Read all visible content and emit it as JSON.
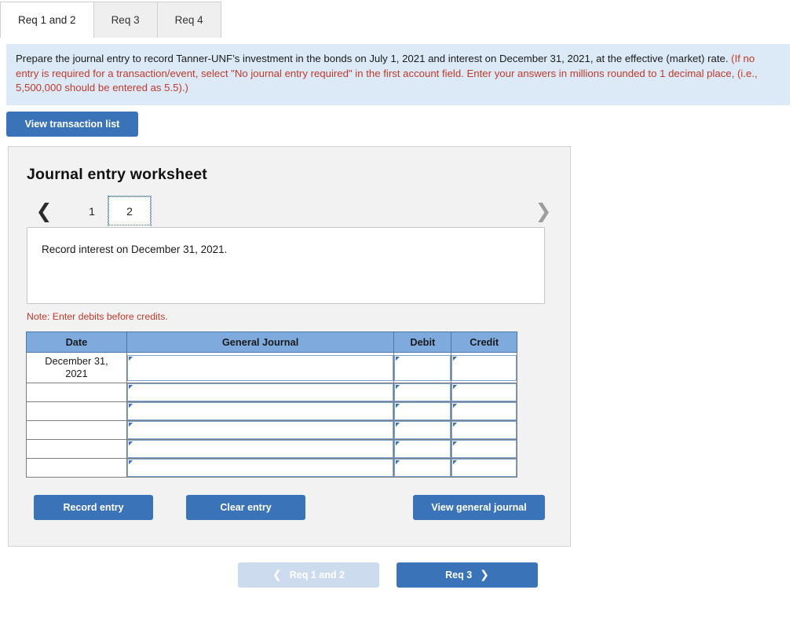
{
  "tabs": [
    {
      "label": "Req 1 and 2",
      "active": true
    },
    {
      "label": "Req 3",
      "active": false
    },
    {
      "label": "Req 4",
      "active": false
    }
  ],
  "instructions": {
    "line_black": "Prepare the journal entry to record Tanner-UNF’s investment in the bonds on July 1, 2021 and interest on December 31, 2021, at the effective (market) rate. ",
    "line_red": "(If no entry is required for a transaction/event, select \"No journal entry required\" in the first account field. Enter your answers in millions rounded to 1 decimal place, (i.e., 5,500,000 should be entered as 5.5).)"
  },
  "toolbar": {
    "view_transaction_list": "View transaction list"
  },
  "worksheet": {
    "title": "Journal entry worksheet",
    "pager": {
      "prev_icon": "chevron-left",
      "next_icon": "chevron-right",
      "pages": [
        "1",
        "2"
      ],
      "selected_page": "2"
    },
    "description": "Record interest on December 31, 2021.",
    "note": "Note: Enter debits before credits."
  },
  "table": {
    "headers": [
      "Date",
      "General Journal",
      "Debit",
      "Credit"
    ],
    "rows": [
      {
        "date": "December 31,\n2021",
        "general_journal": "",
        "debit": "",
        "credit": "",
        "tall": true
      },
      {
        "date": "",
        "general_journal": "",
        "debit": "",
        "credit": "",
        "tall": false
      },
      {
        "date": "",
        "general_journal": "",
        "debit": "",
        "credit": "",
        "tall": false
      },
      {
        "date": "",
        "general_journal": "",
        "debit": "",
        "credit": "",
        "tall": false
      },
      {
        "date": "",
        "general_journal": "",
        "debit": "",
        "credit": "",
        "tall": false
      },
      {
        "date": "",
        "general_journal": "",
        "debit": "",
        "credit": "",
        "tall": false
      }
    ]
  },
  "actions": {
    "record_entry": "Record entry",
    "clear_entry": "Clear entry",
    "view_general_journal": "View general journal"
  },
  "nav": {
    "prev_label": "Req 1 and 2",
    "prev_icon": "chevron-left",
    "prev_disabled": true,
    "next_label": "Req 3",
    "next_icon": "chevron-right",
    "next_disabled": false
  },
  "colors": {
    "accent_blue": "#3b73b9",
    "accent_blue_disabled": "#ccdcee",
    "banner_bg": "#dceaf7",
    "panel_bg": "#f2f2f2",
    "table_header_bg": "#7eaade",
    "red_text": "#c0392b"
  }
}
